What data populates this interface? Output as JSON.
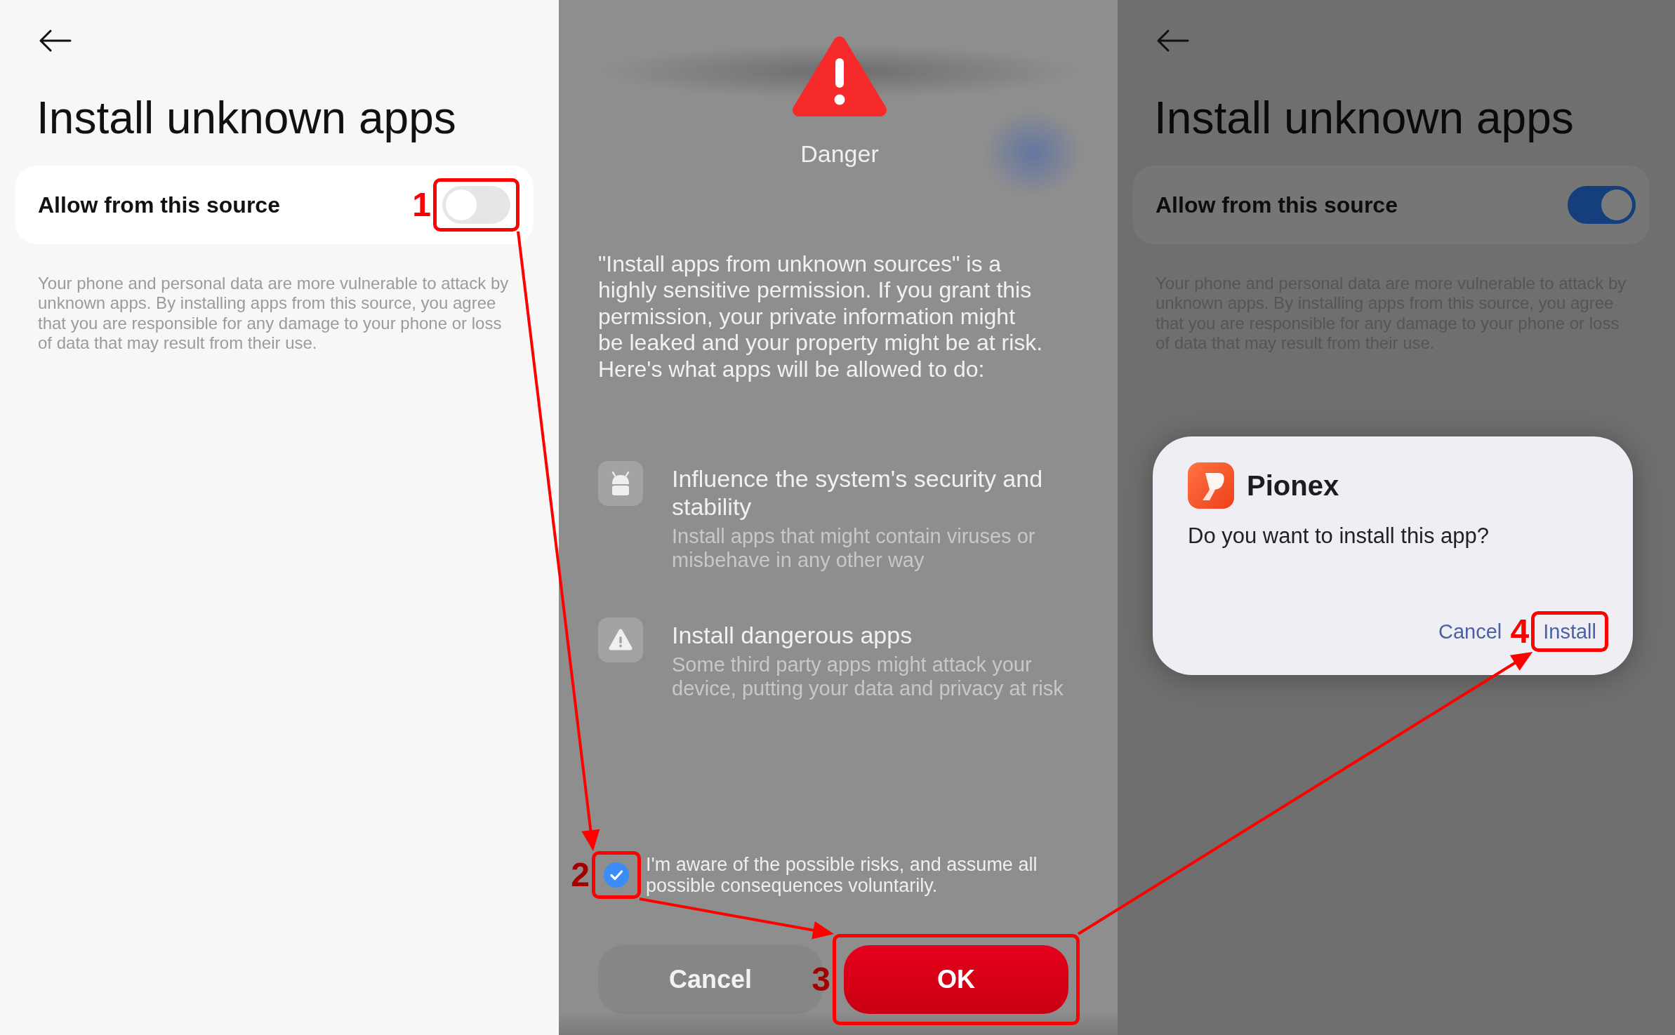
{
  "screens": [
    {
      "kind": "settings",
      "dimmed": false,
      "title": "Install unknown apps",
      "setting": {
        "label": "Allow from this source",
        "on": false,
        "step": "1"
      },
      "description": "Your phone and personal data are more vulnerable to attack by unknown apps. By installing apps from this source, you agree that you are responsible for any damage to your phone or loss of data that may result from their use."
    },
    {
      "kind": "warning",
      "heading": "Danger",
      "message": "\"Install apps from unknown sources\" is a highly sensitive permission. If you grant this permission, your private information might be leaked and your property might be at risk. Here's what apps will be allowed to do:",
      "permissions": [
        {
          "kind": "system",
          "title": "Influence the system's security and stability",
          "description": "Install apps that might contain viruses or misbehave in any other way"
        },
        {
          "kind": "danger",
          "title": "Install dangerous apps",
          "description": "Some third party apps might attack your device, putting your data and privacy at risk"
        }
      ],
      "consent": {
        "text": "I'm aware of the possible risks, and assume all possible consequences voluntarily.",
        "checked": true,
        "step": "2"
      },
      "buttons": [
        {
          "label": "Cancel",
          "kind": "secondary"
        },
        {
          "label": "OK",
          "kind": "primary",
          "step": "3"
        }
      ]
    },
    {
      "kind": "settings",
      "dimmed": true,
      "title": "Install unknown apps",
      "setting": {
        "label": "Allow from this source",
        "on": true
      },
      "description": "Your phone and personal data are more vulnerable to attack by unknown apps. By installing apps from this source, you agree that you are responsible for any damage to your phone or loss of data that may result from their use.",
      "dialog": {
        "app_name": "Pionex",
        "message": "Do you want to install this app?",
        "buttons": [
          {
            "label": "Cancel"
          },
          {
            "label": "Install",
            "step": "4"
          }
        ]
      }
    }
  ]
}
